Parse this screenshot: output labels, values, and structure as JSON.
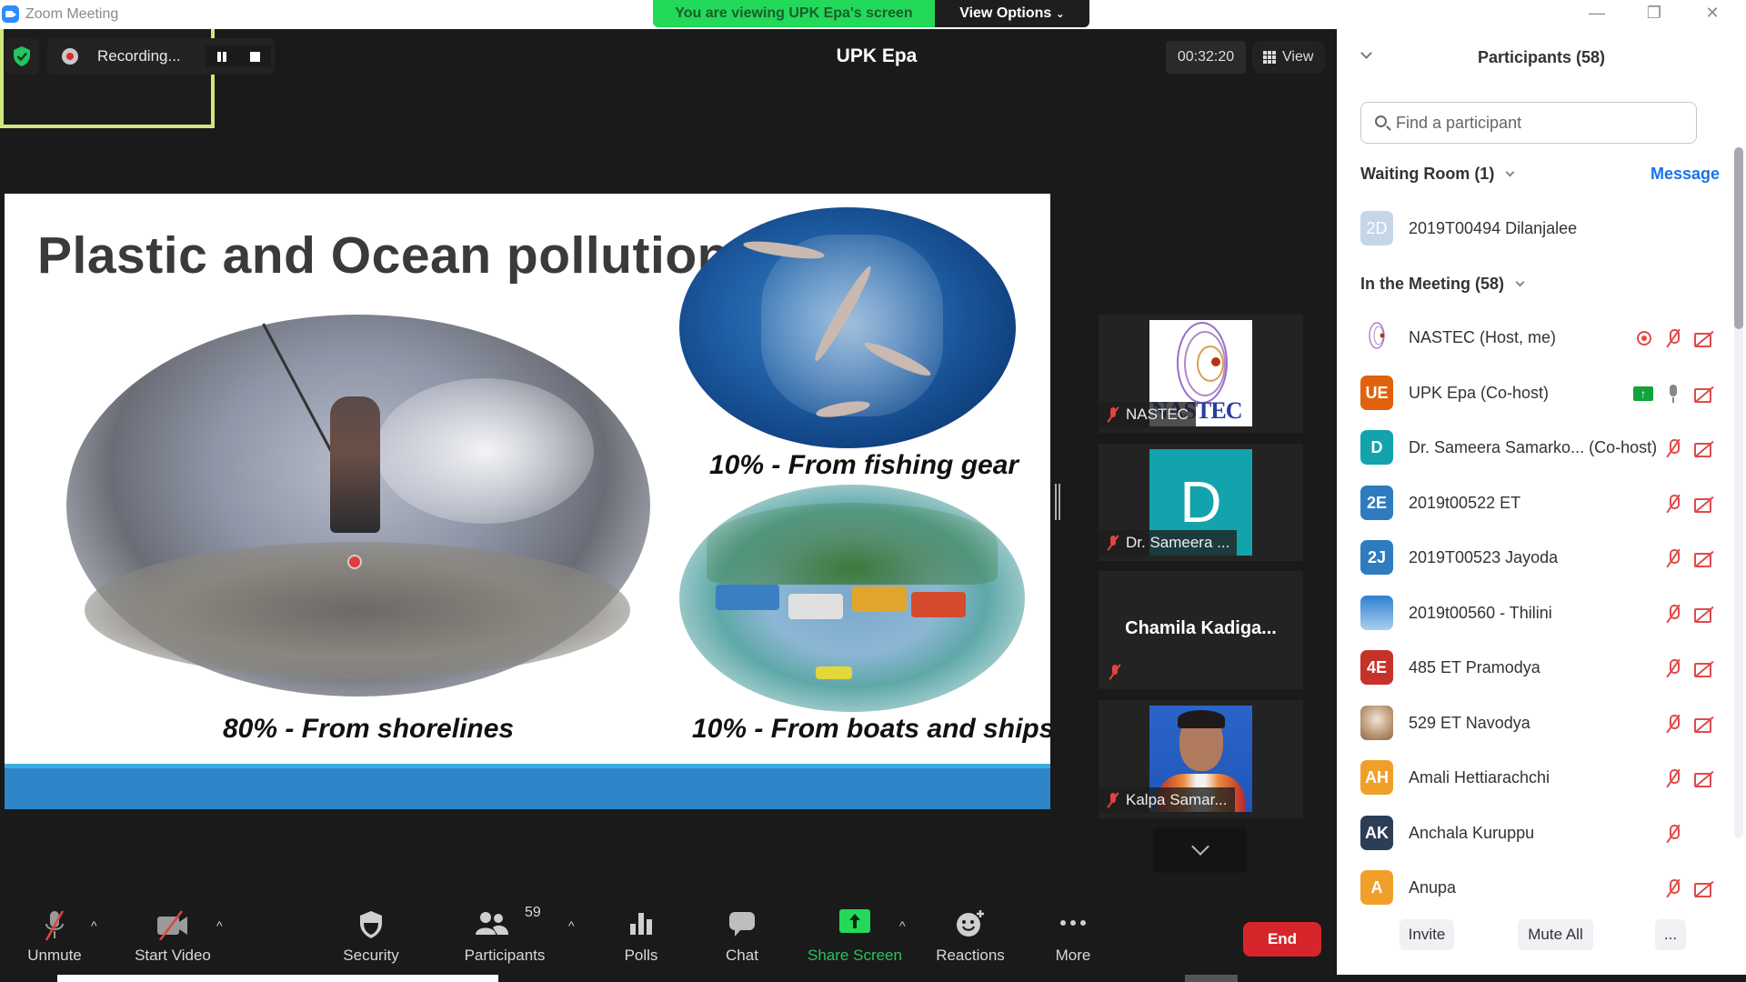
{
  "window": {
    "title": "Zoom Meeting",
    "controls": [
      "minimize",
      "restore",
      "close"
    ]
  },
  "banner": {
    "text": "You are viewing UPK Epa's screen",
    "view_options": "View Options"
  },
  "recording": {
    "label": "Recording...",
    "pause_icon": "pause-icon",
    "stop_icon": "stop-icon"
  },
  "timer": "00:32:20",
  "view_button": "View",
  "slide": {
    "title": "Plastic and Ocean pollution",
    "captions": {
      "fishing": "10% - From fishing gear",
      "shorelines": "80% -  From shorelines",
      "boats": "10% - From boats and ships"
    },
    "colors": {
      "band": "#2e86c9",
      "band_top": "#39aee0"
    }
  },
  "tiles": [
    {
      "name": "UPK Epa",
      "active_speaker": true
    },
    {
      "name": "NASTEC",
      "logo_text": "NASTEC",
      "muted": true
    },
    {
      "name": "Dr. Sameera ...",
      "avatar_letter": "D",
      "muted": true
    },
    {
      "name": "Chamila  Kadiga...",
      "muted": true
    },
    {
      "name": "Kalpa Samar...",
      "muted": true
    }
  ],
  "toolbar": {
    "unmute": "Unmute",
    "start_video": "Start Video",
    "security": "Security",
    "participants": "Participants",
    "participants_count": "59",
    "polls": "Polls",
    "chat": "Chat",
    "share_screen": "Share Screen",
    "reactions": "Reactions",
    "more": "More",
    "end": "End"
  },
  "panel": {
    "title": "Participants (58)",
    "search_placeholder": "Find a participant",
    "waiting_room": {
      "header": "Waiting Room (1)",
      "message_link": "Message",
      "items": [
        {
          "initials": "2D",
          "name": "2019T00494 Dilanjalee",
          "color": "#c5d6e8"
        }
      ]
    },
    "in_meeting": {
      "header": "In the Meeting (58)",
      "items": [
        {
          "initials": "",
          "name": "NASTEC (Host, me)",
          "color": "#ffffff",
          "avatar": "nastec-logo",
          "recording": true,
          "mic": "muted",
          "video": "off"
        },
        {
          "initials": "UE",
          "name": "UPK Epa (Co-host)",
          "color": "#e0610e",
          "sharing": true,
          "mic": "on",
          "video": "off"
        },
        {
          "initials": "D",
          "name": "Dr. Sameera Samarko... (Co-host)",
          "color": "#13a3ad",
          "mic": "muted",
          "video": "off"
        },
        {
          "initials": "2E",
          "name": "2019t00522 ET",
          "color": "#2e7bbf",
          "mic": "muted",
          "video": "off"
        },
        {
          "initials": "2J",
          "name": "2019T00523 Jayoda",
          "color": "#2e7bbf",
          "mic": "muted",
          "video": "off"
        },
        {
          "initials": "",
          "name": "2019t00560 - Thilini",
          "color": "#5a9fdc",
          "avatar": "sky-photo",
          "mic": "muted",
          "video": "off"
        },
        {
          "initials": "4E",
          "name": "485 ET Pramodya",
          "color": "#c53229",
          "mic": "muted",
          "video": "off"
        },
        {
          "initials": "",
          "name": "529 ET Navodya",
          "color": "#d9c7b3",
          "avatar": "photo",
          "mic": "muted",
          "video": "off"
        },
        {
          "initials": "AH",
          "name": "Amali Hettiarachchi",
          "color": "#f0a02a",
          "mic": "muted",
          "video": "off"
        },
        {
          "initials": "AK",
          "name": "Anchala Kuruppu",
          "color": "#2c3e57",
          "mic": "muted",
          "video": null
        },
        {
          "initials": "A",
          "name": "Anupa",
          "color": "#f0a02a",
          "mic": "muted",
          "video": "off"
        }
      ]
    },
    "footer": {
      "invite": "Invite",
      "mute_all": "Mute All",
      "more": "..."
    }
  }
}
